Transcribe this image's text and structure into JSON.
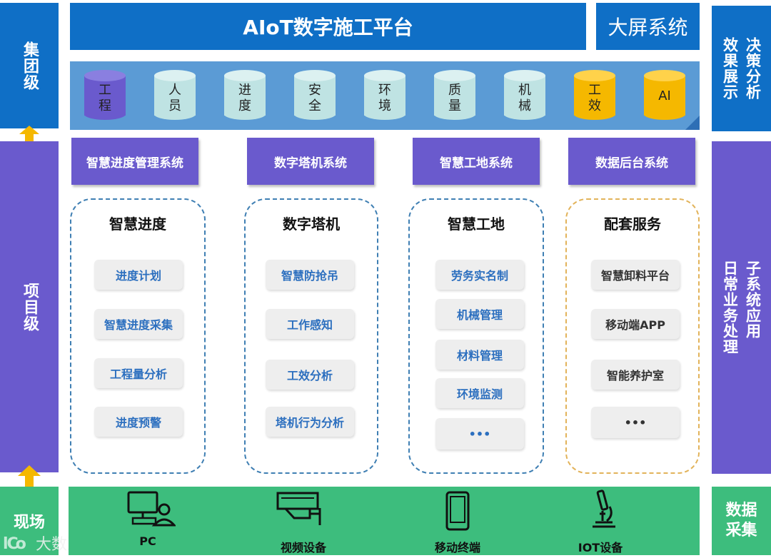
{
  "left_labels": {
    "group": "集团级",
    "project": "项目级",
    "site": "现场"
  },
  "right_labels": {
    "decision": "决策分析效果展示",
    "decision_col1": "决策分析",
    "decision_col2": "效果展示",
    "subsys": "子系统应用日常业务处理",
    "subsys_col1": "子系统应用",
    "subsys_col2": "日常业务处理",
    "data": "数据采集"
  },
  "header": {
    "platform": "AIoT数字施工平台",
    "bigscreen": "大屏系统"
  },
  "data_stores": [
    {
      "label": "工程",
      "color": "#6a5acd"
    },
    {
      "label": "人员",
      "color": "#bfe3e3"
    },
    {
      "label": "进度",
      "color": "#bfe3e3"
    },
    {
      "label": "安全",
      "color": "#bfe3e3"
    },
    {
      "label": "环境",
      "color": "#bfe3e3"
    },
    {
      "label": "质量",
      "color": "#bfe3e3"
    },
    {
      "label": "机械",
      "color": "#bfe3e3"
    },
    {
      "label": "工效",
      "color": "#f5b800"
    },
    {
      "label": "AI",
      "color": "#f5b800"
    }
  ],
  "systems": [
    "智慧进度管理系统",
    "数字塔机系统",
    "智慧工地系统",
    "数据后台系统"
  ],
  "groups": [
    {
      "title": "智慧进度",
      "items": [
        "进度计划",
        "智慧进度采集",
        "工程量分析",
        "进度预警"
      ]
    },
    {
      "title": "数字塔机",
      "items": [
        "智慧防抢吊",
        "工作感知",
        "工效分析",
        "塔机行为分析"
      ]
    },
    {
      "title": "智慧工地",
      "items": [
        "劳务实名制",
        "机械管理",
        "材料管理",
        "环境监测",
        "•••"
      ]
    },
    {
      "title": "配套服务",
      "items": [
        "智慧卸料平台",
        "移动端APP",
        "智能养护室",
        "•••"
      ]
    }
  ],
  "devices": [
    {
      "label": "PC",
      "icon": "pc-user-icon"
    },
    {
      "label": "视频设备",
      "icon": "camera-icon"
    },
    {
      "label": "移动终端",
      "icon": "phone-icon"
    },
    {
      "label": "IOT设备",
      "icon": "microscope-icon"
    }
  ],
  "watermark": "大数跨境",
  "colors": {
    "blue": "#0f6fc6",
    "purple": "#6a5acd",
    "green": "#3dbd7d",
    "arrow": "#f5b800"
  }
}
